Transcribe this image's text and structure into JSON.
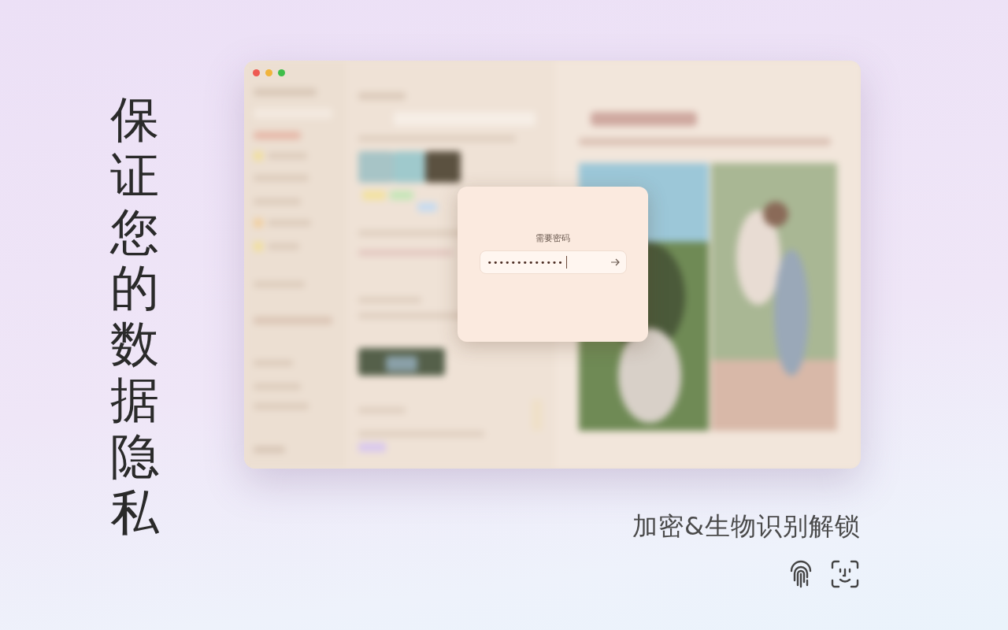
{
  "headline": "保证您的数据隐私",
  "window": {
    "dialog": {
      "title": "需要密码",
      "password": {
        "value": "•••••••••••••",
        "focused": true
      }
    }
  },
  "caption": "加密&生物识别解锁"
}
